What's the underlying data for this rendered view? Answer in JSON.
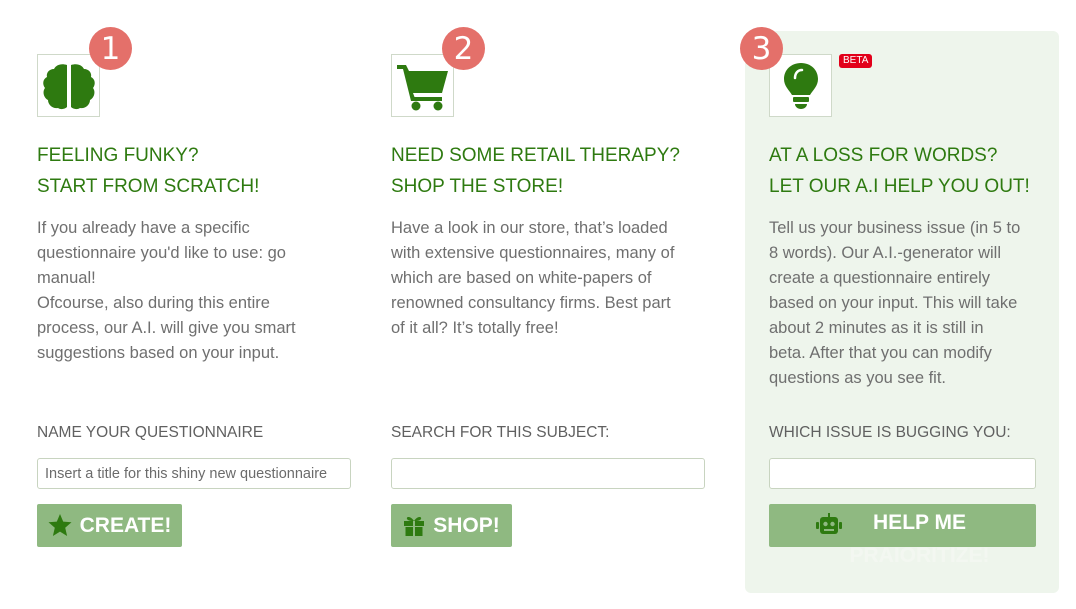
{
  "columns": [
    {
      "step": "1",
      "icon": "brain-icon",
      "title_line1": "FEELING FUNKY?",
      "title_line2": "START FROM SCRATCH!",
      "desc_lines": [
        "If you already have a specific",
        "questionnaire you'd like to use: go",
        "manual!",
        "Ofcourse, also during this entire",
        "process, our A.I. will give you smart",
        "suggestions based on your input."
      ],
      "field_label": "NAME YOUR QUESTIONNAIRE",
      "input_placeholder": "Insert a title for this shiny new questionnaire",
      "input_value": "",
      "button_label": "CREATE!",
      "button_icon": "star-icon"
    },
    {
      "step": "2",
      "icon": "cart-icon",
      "title_line1": "NEED SOME RETAIL THERAPY?",
      "title_line2": "SHOP THE STORE!",
      "desc_lines": [
        "Have a look in our store, that’s loaded",
        "with extensive questionnaires, many of",
        "which are based on white-papers of",
        "renowned consultancy firms. Best part",
        "of it all? It’s totally free!"
      ],
      "field_label": "SEARCH FOR THIS SUBJECT:",
      "input_placeholder": "",
      "input_value": "",
      "button_label": "SHOP!",
      "button_icon": "gift-icon"
    },
    {
      "step": "3",
      "icon": "lightbulb-icon",
      "badge": "BETA",
      "title_line1": "AT A LOSS FOR WORDS?",
      "title_line2": "LET OUR A.I HELP YOU OUT!",
      "desc_lines": [
        "Tell us your business issue (in 5 to",
        "8 words). Our A.I.-generator will",
        "create a questionnaire entirely",
        "based on your input. This will take",
        "about 2 minutes as it is still in",
        "beta. After that you can modify",
        "questions as you see fit."
      ],
      "field_label": "WHICH ISSUE IS BUGGING YOU:",
      "input_placeholder": "",
      "input_value": "",
      "button_label": "HELP ME",
      "button_label_overflow": "PRAIORITIZE!",
      "button_icon": "robot-icon"
    }
  ],
  "colors": {
    "accent_green": "#2e7a10",
    "button_green": "#8fb981",
    "step_badge": "#e4706a",
    "beta_badge": "#e2001a",
    "highlight_panel": "#eef5ec"
  }
}
